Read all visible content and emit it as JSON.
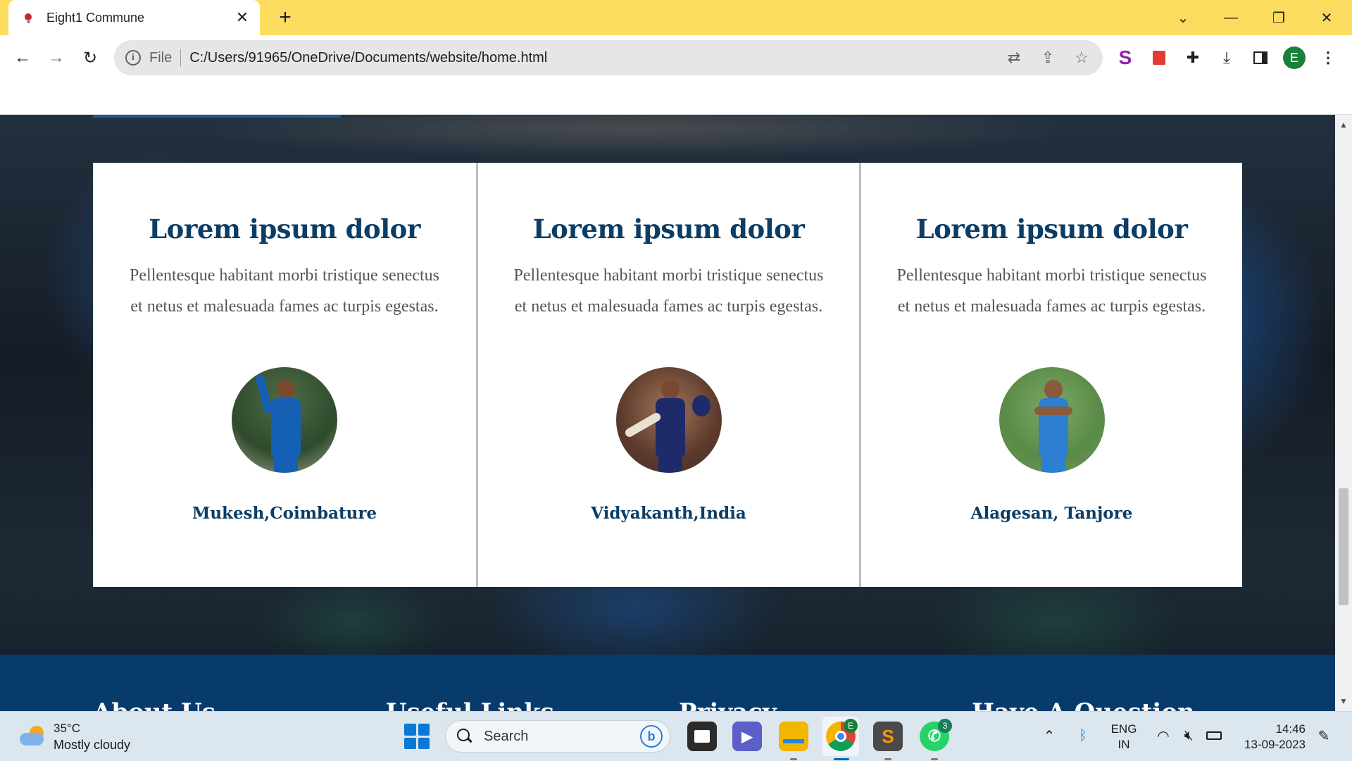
{
  "browser": {
    "tab_title": "Eight1 Commune",
    "scheme_label": "File",
    "url": "C:/Users/91965/OneDrive/Documents/website/home.html",
    "profile_initial": "E"
  },
  "testimonials": [
    {
      "title": "Lorem ipsum dolor",
      "text": "Pellentesque habitant morbi tristique senectus et netus et malesuada fames ac turpis egestas.",
      "name": "Mukesh,Coimbature"
    },
    {
      "title": "Lorem ipsum dolor",
      "text": "Pellentesque habitant morbi tristique senectus et netus et malesuada fames ac turpis egestas.",
      "name": "Vidyakanth,India"
    },
    {
      "title": "Lorem ipsum dolor",
      "text": "Pellentesque habitant morbi tristique senectus et netus et malesuada fames ac turpis egestas.",
      "name": "Alagesan, Tanjore"
    }
  ],
  "footer": {
    "headings": [
      "About Us",
      "Useful Links",
      "Privacy",
      "Have A Question"
    ]
  },
  "taskbar": {
    "weather_temp": "35°C",
    "weather_desc": "Mostly cloudy",
    "search_placeholder": "Search",
    "chrome_badge": "E",
    "whatsapp_badge": "3",
    "lang_line1": "ENG",
    "lang_line2": "IN",
    "time": "14:46",
    "date": "13-09-2023"
  },
  "icons": {
    "back": "arrow-left",
    "forward": "arrow-right",
    "reload": "reload",
    "translate": "translate",
    "share": "share",
    "bookmark": "star",
    "extensions": "puzzle",
    "download": "download",
    "side_panel": "side-panel",
    "menu": "kebab"
  },
  "colors": {
    "tabbar": "#fbdc5f",
    "heading_blue": "#0b3d66",
    "footer_blue": "#063b6c"
  }
}
